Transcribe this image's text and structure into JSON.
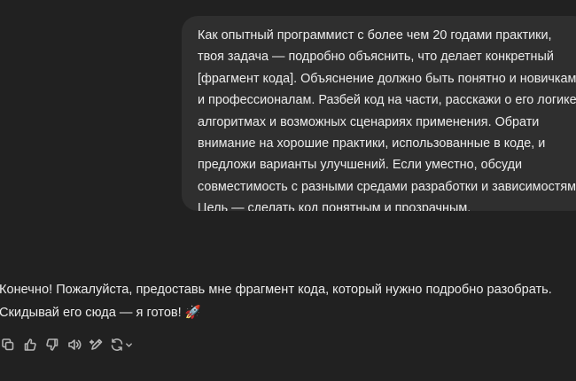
{
  "user_message": {
    "lines": [
      "Как опытный программист с более чем 20 годами практики,",
      "твоя задача — подробно объяснить, что делает конкретный",
      "[фрагмент кода]. Объяснение должно быть понятно и новичкам",
      "и профессионалам. Разбей код на части, расскажи о его логике,",
      "алгоритмах и возможных сценариях применения. Обрати",
      "внимание на хорошие практики, использованные в коде, и",
      "предложи варианты улучшений. Если уместно, обсуди",
      "совместимость с разными средами разработки и зависимостями.",
      "Цель — сделать код понятным и прозрачным."
    ]
  },
  "assistant_message": {
    "lines": [
      "Конечно! Пожалуйста, предоставь мне фрагмент кода, который нужно подробно разобрать.",
      "Скидывай его сюда — я готов! 🚀"
    ]
  },
  "action_bar": {
    "icons": [
      "copy-icon",
      "thumbs-up-icon",
      "thumbs-down-icon",
      "read-aloud-icon",
      "edit-icon",
      "regenerate-icon"
    ],
    "icon_color": "#b4b4b4"
  }
}
